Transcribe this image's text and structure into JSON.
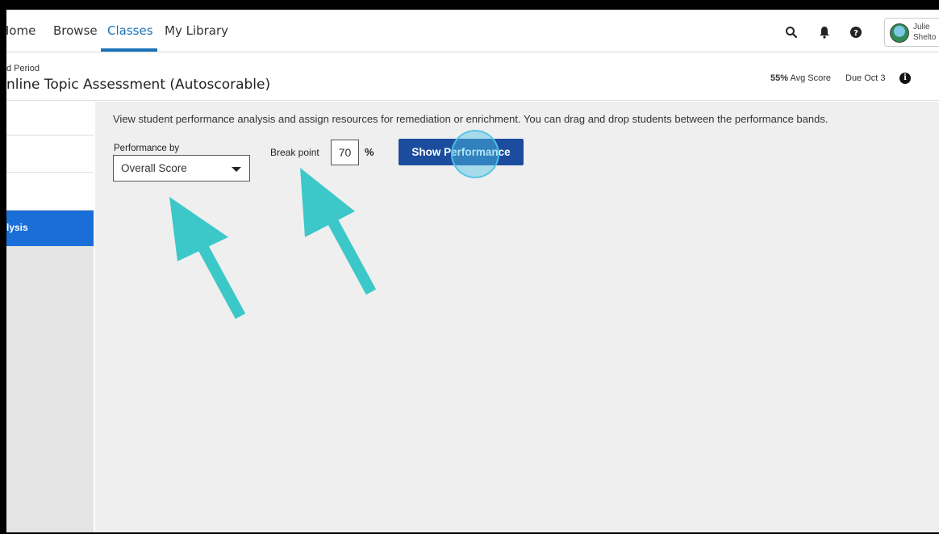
{
  "nav": {
    "items": [
      "Home",
      "Browse",
      "Classes",
      "My Library"
    ],
    "active": "Classes"
  },
  "icons": {
    "search": "search-icon",
    "notifications": "bell-icon",
    "help": "help-icon",
    "info": "info-icon"
  },
  "user": {
    "first_name": "Julie",
    "last_name": "Shelto"
  },
  "assignment": {
    "period": "d Period",
    "title": "nline Topic Assessment (Autoscorable)",
    "avg_score_value": "55%",
    "avg_score_label": "Avg Score",
    "due": "Due Oct 3"
  },
  "sidebar": {
    "active_label": "lysis"
  },
  "main": {
    "description": "View student performance analysis and assign resources for remediation or enrichment. You can drag and drop students between the performance bands.",
    "performance_by_label": "Performance by",
    "performance_by_value": "Overall Score",
    "break_point_label": "Break point",
    "break_point_value": "70",
    "break_point_unit": "%",
    "show_button_label": "Show Performance"
  },
  "colors": {
    "accent": "#1a73b8",
    "sidebar_active": "#1a6ed8",
    "button": "#1b4c9e",
    "annotation_arrow": "#3cc8c8"
  }
}
